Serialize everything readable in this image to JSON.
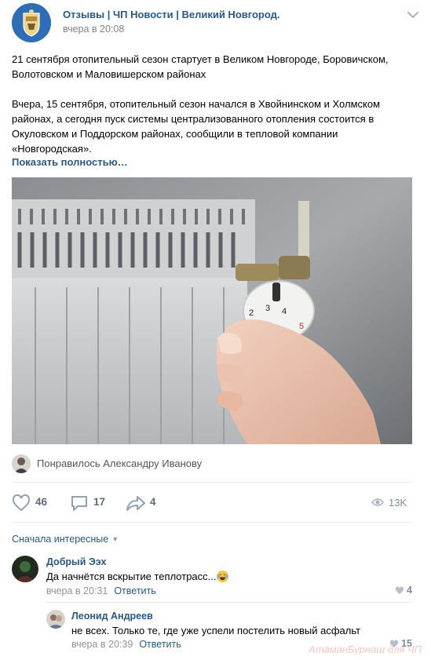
{
  "post": {
    "group_name": "Отзывы | ЧП Новости | Великий Новгород.",
    "time": "вчера в 20:08",
    "paragraph1": "21 сентября отопительный сезон стартует в Великом Новгороде, Боровичском, Волотовском и Маловишерском районах",
    "paragraph2": "Вчера, 15 сентября, отопительный сезон начался в Хвойнинском и Холмском районах, а сегодня пуск системы централизованного отопления состоится в Окуловском и Поддорском районах, сообщили в тепловой компании «Новгородская».",
    "show_more": "Показать полностью…",
    "photo_icon": "radiator-thermostat-photo",
    "liked_by": "Понравилось Александру Иванову",
    "likes": "46",
    "comments": "17",
    "shares": "4",
    "views": "13K",
    "thermostat_labels": [
      "2",
      "3",
      "4",
      "5"
    ]
  },
  "comments_section": {
    "sort_label": "Сначала интересные",
    "items": [
      {
        "author": "Добрый Ээх",
        "text": "Да начнётся вскрытие теплотрасс...",
        "emoji": "laughing-tears-emoji",
        "time": "вчера в 20:31",
        "reply": "Ответить",
        "likes": "4"
      },
      {
        "author": "Леонид Андреев",
        "text": "не всех. Только те, где уже успели постелить новый асфальт",
        "time": "вчера в 20:39",
        "reply": "Ответить",
        "likes": "15"
      }
    ]
  },
  "watermark": "АтаманБурнаш для ЧП",
  "colors": {
    "link": "#2a5885",
    "secondary": "#828282",
    "icon": "#8fa1b4",
    "divider": "#e7e8ec"
  }
}
